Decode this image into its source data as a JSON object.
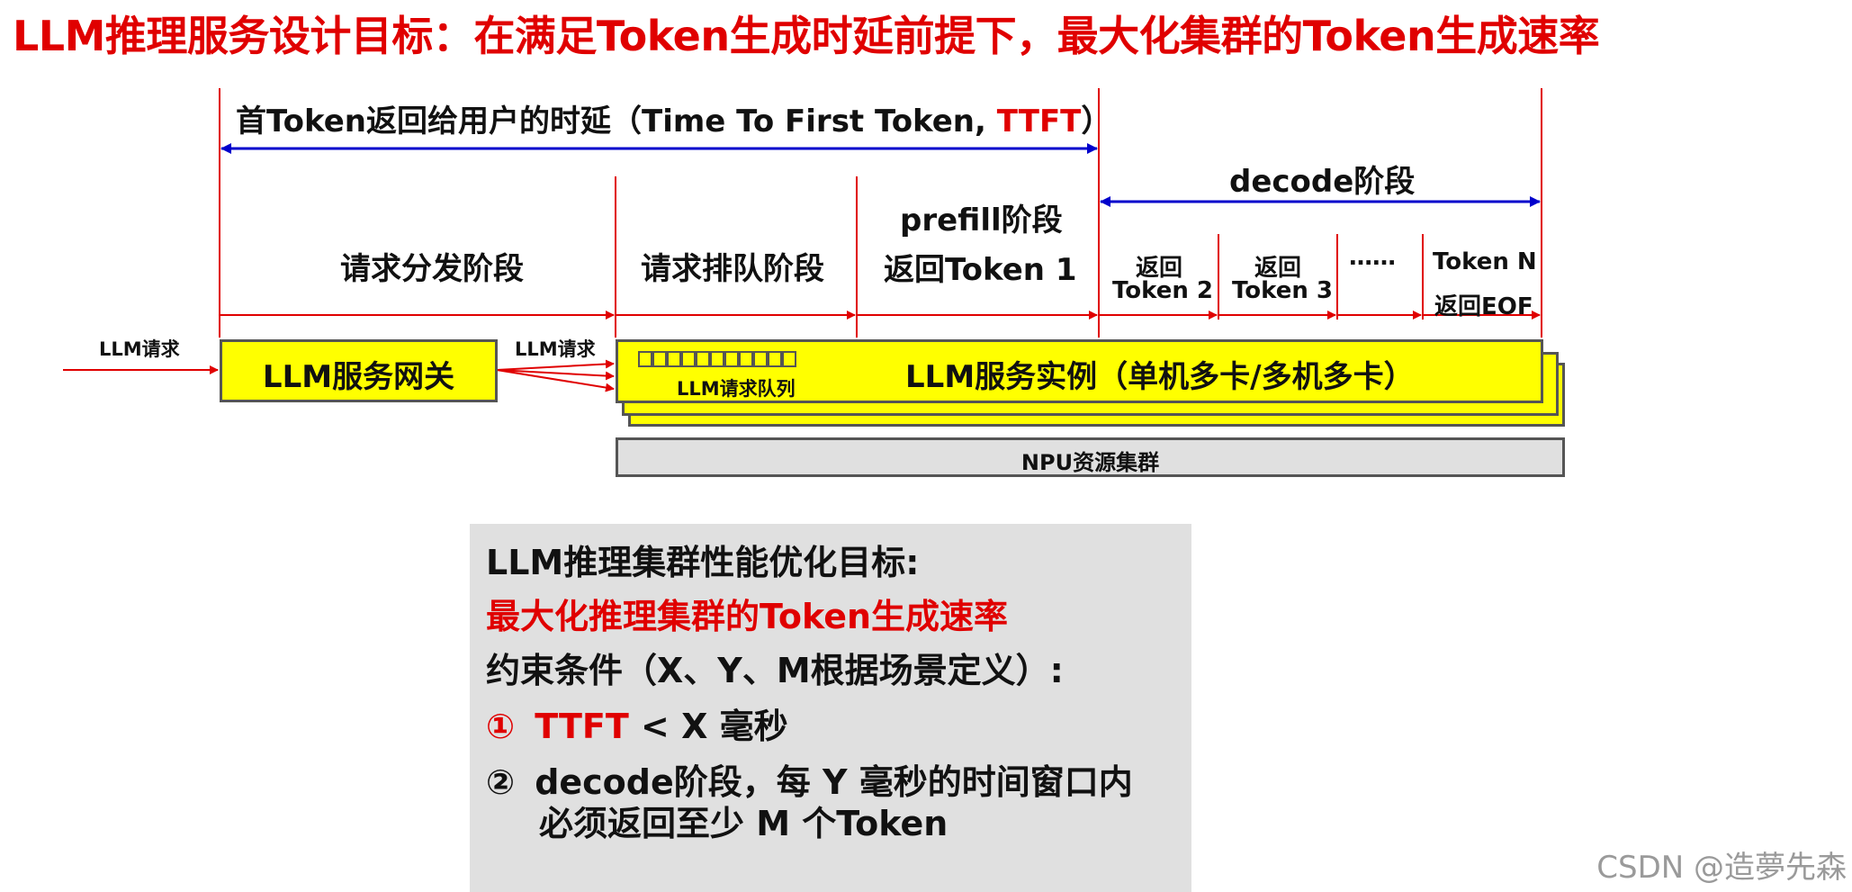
{
  "title": "LLM推理服务设计目标：在满足Token生成时延前提下，最大化集群的Token生成速率",
  "ttft": {
    "label_prefix": "首Token返回给用户的时延（Time To First Token, ",
    "label_highlight": "TTFT",
    "label_suffix": "）"
  },
  "decode_label": "decode阶段",
  "stages": {
    "dispatch": "请求分发阶段",
    "queue": "请求排队阶段",
    "prefill_line1": "prefill阶段",
    "prefill_line2": "返回Token 1",
    "token2_line1": "返回",
    "token2_line2": "Token 2",
    "token3_line1": "返回",
    "token3_line2": "Token 3",
    "ellipsis": "……",
    "tokenN_line1": "Token N",
    "tokenN_line2": "返回EOF"
  },
  "request_in_label": "LLM请求",
  "gateway_label": "LLM服务网关",
  "request_fanout_label": "LLM请求",
  "queue_label": "LLM请求队列",
  "instance_label": "LLM服务实例（单机多卡/多机多卡）",
  "npu_label": "NPU资源集群",
  "panel": {
    "line1": "LLM推理集群性能优化目标:",
    "line2": "最大化推理集群的Token生成速率",
    "line3": "约束条件（X、Y、M根据场景定义）:",
    "c1_num": "①",
    "c1_red": "TTFT",
    "c1_rest": "< X 毫秒",
    "c2_num": "②",
    "c2_line1": "decode阶段，每 Y 毫秒的时间窗口内",
    "c2_line2": "必须返回至少 M 个Token"
  },
  "watermark": "CSDN @造夢先森",
  "colors": {
    "red": "#e00000",
    "blue": "#0000cc",
    "yellow": "#ffff00",
    "gray": "#e0e0e0"
  }
}
